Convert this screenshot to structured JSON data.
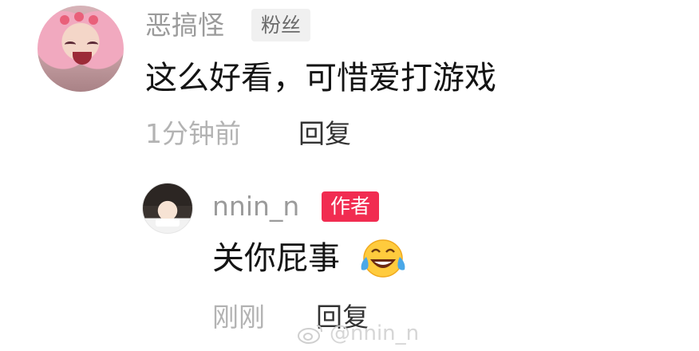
{
  "comment": {
    "username": "恶搞怪",
    "badge": "粉丝",
    "text": "这么好看，可惜爱打游戏",
    "time": "1分钟前",
    "reply_label": "回复"
  },
  "reply": {
    "username": "nnin_n",
    "badge": "作者",
    "text": "关你屁事",
    "emoji": "laughing-tears-emoji",
    "time": "刚刚",
    "reply_label": "回复"
  },
  "watermark": {
    "text": "@nnin_n",
    "icon": "weibo-icon"
  },
  "colors": {
    "author_badge": "#f12c51",
    "fan_badge_bg": "#f0f0f0",
    "muted_text": "#9b9b9b"
  }
}
